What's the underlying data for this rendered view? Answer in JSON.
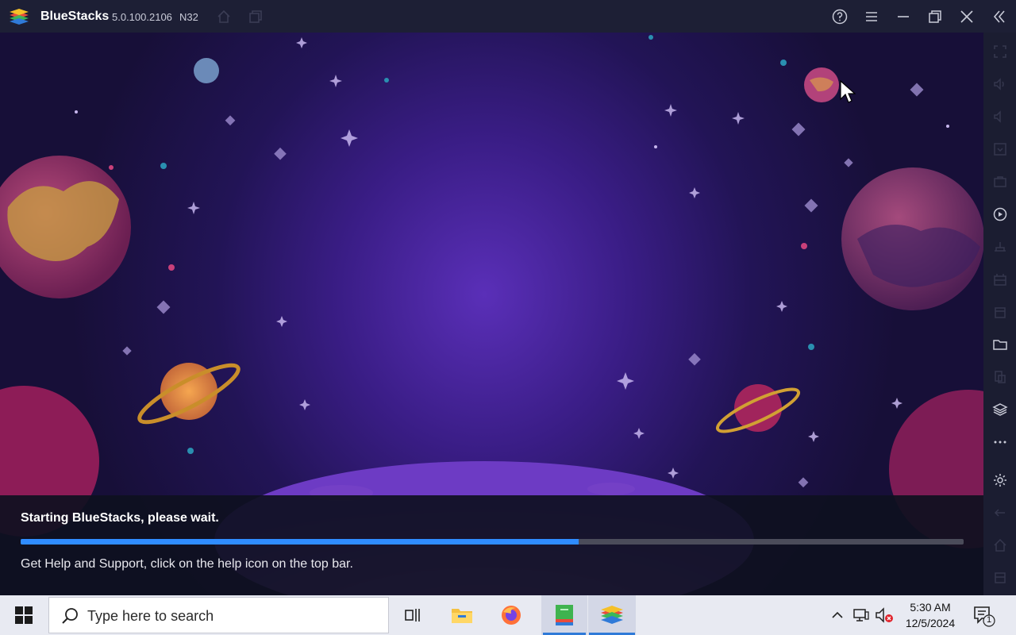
{
  "titlebar": {
    "app_name": "BlueStacks",
    "version": "5.0.100.2106",
    "arch": "N32",
    "icons": [
      "bluestacks-logo",
      "home-icon",
      "multi-instance-icon",
      "help-icon",
      "menu-icon",
      "minimize-icon",
      "restore-icon",
      "close-icon",
      "collapse-sidebar-icon"
    ]
  },
  "loading": {
    "title": "Starting BlueStacks, please wait.",
    "progress": 0.592,
    "help_text": "Get Help and Support, click on the help icon on the top bar."
  },
  "sidebar": {
    "icons": [
      "fullscreen-icon",
      "volume-up-icon",
      "volume-down-icon",
      "screen-icon",
      "keyboard-icon",
      "macro-record-icon",
      "install-apk-icon",
      "screenshot-icon",
      "location-icon",
      "media-folder-icon",
      "multi-instance-manager-icon",
      "layers-icon",
      "more-icon",
      "settings-icon",
      "back-icon",
      "home-icon",
      "recent-apps-icon"
    ]
  },
  "taskbar": {
    "search_placeholder": "Type here to search",
    "time": "5:30 AM",
    "date": "12/5/2024",
    "notification_count": "1",
    "apps": [
      "task-view-icon",
      "file-explorer-icon",
      "firefox-icon",
      "app-installer-icon",
      "bluestacks-icon"
    ]
  },
  "colors": {
    "titlebar": "#1d1f35",
    "progress_fill": "#2f8cff",
    "progress_track": "#4b4c5a",
    "taskbar": "#e8eaf2"
  }
}
